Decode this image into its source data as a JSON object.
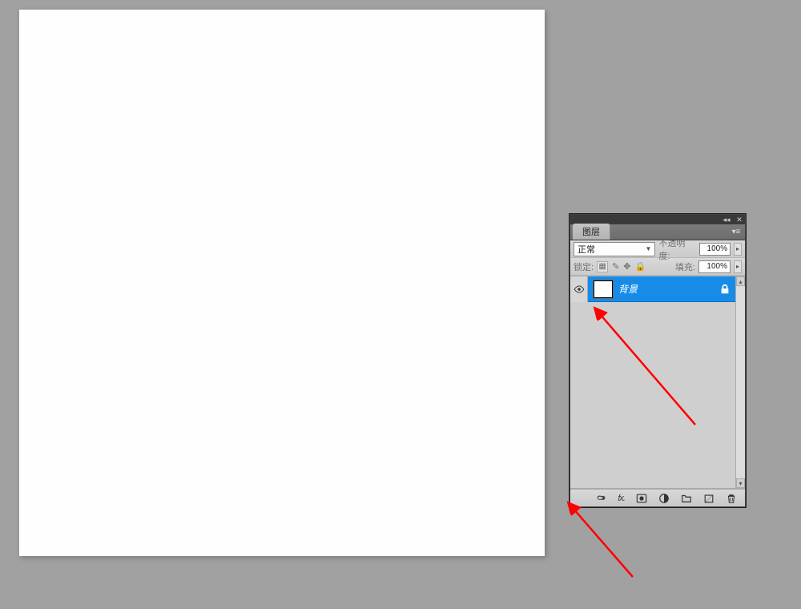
{
  "panel": {
    "tab_label": "图层",
    "blend_mode": "正常",
    "opacity_label": "不透明度:",
    "opacity_value": "100%",
    "lock_label": "锁定:",
    "fill_label": "填充:",
    "fill_value": "100%"
  },
  "layer": {
    "name": "背景"
  },
  "icons": {
    "eye": "eye-icon",
    "lock": "lock-icon",
    "link": "link-icon",
    "fx": "fx.",
    "mask": "mask-icon",
    "adjust": "adjust-icon",
    "group": "group-icon",
    "newlayer": "new-layer-icon",
    "trash": "trash-icon",
    "menu": "≡",
    "collapse": "◂◂",
    "close": "✕"
  }
}
